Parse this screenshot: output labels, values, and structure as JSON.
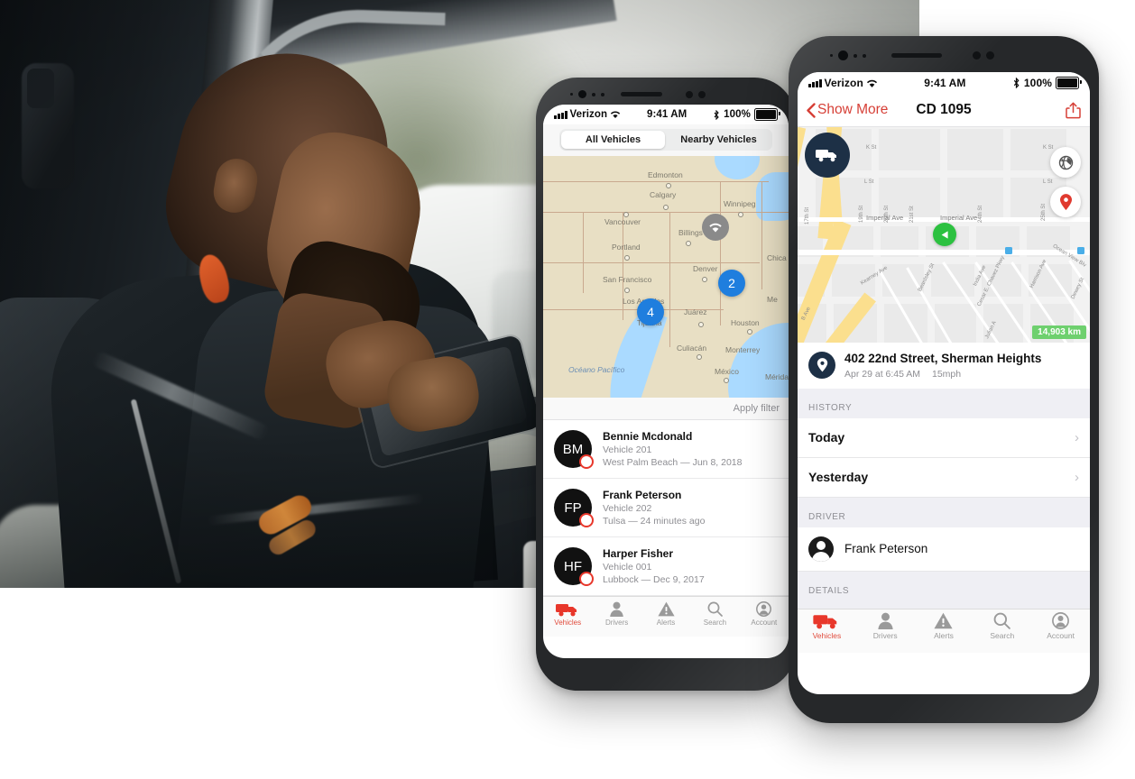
{
  "hero": {
    "alt": "delivery driver seated in truck cab using a tablet"
  },
  "phone_list": {
    "status_bar": {
      "carrier": "Verizon",
      "time": "9:41 AM",
      "battery": "100%",
      "signal_icon": "cellular-signal-icon",
      "wifi_icon": "wifi-icon",
      "bluetooth_icon": "bluetooth-icon",
      "battery_icon": "battery-icon"
    },
    "segmented": {
      "options": [
        "All Vehicles",
        "Nearby Vehicles"
      ],
      "selected": "All Vehicles"
    },
    "map": {
      "wifi_badge_icon": "wifi-badge-icon",
      "clusters": [
        {
          "count": "4"
        },
        {
          "count": "2"
        }
      ],
      "cities": [
        "Edmonton",
        "Calgary",
        "Winnipeg",
        "Vancouver",
        "Billings",
        "Portland",
        "Denver",
        "Chica",
        "San Francisco",
        "Los Angeles",
        "Juárez",
        "Tijuana",
        "Houston",
        "Culiacán",
        "Monterrey",
        "México",
        "Mérida",
        "Me",
        "Océano Pacífico"
      ]
    },
    "filter": {
      "label": "Apply filter"
    },
    "vehicles": [
      {
        "initials": "BM",
        "name": "Bennie Mcdonald",
        "vehicle": "Vehicle 201",
        "location": "West Palm Beach — Jun 8, 2018"
      },
      {
        "initials": "FP",
        "name": "Frank Peterson",
        "vehicle": "Vehicle 202",
        "location": "Tulsa — 24 minutes ago"
      },
      {
        "initials": "HF",
        "name": "Harper Fisher",
        "vehicle": "Vehicle 001",
        "location": "Lubbock — Dec 9, 2017"
      }
    ],
    "tabs": [
      {
        "label": "Vehicles",
        "icon": "truck-icon",
        "active": true
      },
      {
        "label": "Drivers",
        "icon": "person-icon",
        "active": false
      },
      {
        "label": "Alerts",
        "icon": "warning-triangle-icon",
        "active": false
      },
      {
        "label": "Search",
        "icon": "search-icon",
        "active": false
      },
      {
        "label": "Account",
        "icon": "account-circle-icon",
        "active": false
      }
    ]
  },
  "phone_detail": {
    "status_bar": {
      "carrier": "Verizon",
      "time": "9:41 AM",
      "battery": "100%"
    },
    "nav": {
      "back_label": "Show More",
      "back_icon": "chevron-left-icon",
      "title": "CD 1095",
      "share_icon": "share-icon"
    },
    "map": {
      "truck_badge_icon": "truck-marker-icon",
      "vehicle_heading_icon": "heading-arrow-icon",
      "layers_icon": "globe-layers-icon",
      "locate_icon": "map-pin-icon",
      "distance_badge": "14,903 km",
      "street_labels": [
        "K St",
        "L St",
        "Imperial Ave",
        "Imperial Ave",
        "17th St",
        "19th St",
        "20th St",
        "21st St",
        "24th St",
        "25th St",
        "Kearney Ave",
        "Beardsley St",
        "India Ave",
        "Harrison Ave",
        "Cesar E. Chavez Pkwy",
        "Ocean View Blv",
        "Dewey St",
        "Julian A",
        "B Ave",
        "25th St"
      ]
    },
    "address": {
      "title": "402 22nd Street, Sherman Heights",
      "date": "Apr 29 at 6:45 AM",
      "speed": "15mph",
      "pin_icon": "location-pin-icon"
    },
    "sections": [
      {
        "header": "HISTORY",
        "rows": [
          {
            "label": "Today"
          },
          {
            "label": "Yesterday"
          }
        ]
      },
      {
        "header": "DRIVER",
        "driver": {
          "name": "Frank Peterson",
          "avatar_icon": "avatar-icon"
        }
      },
      {
        "header": "DETAILS",
        "rows": []
      }
    ],
    "tabs": [
      {
        "label": "Vehicles",
        "icon": "truck-icon",
        "active": true
      },
      {
        "label": "Drivers",
        "icon": "person-icon",
        "active": false
      },
      {
        "label": "Alerts",
        "icon": "warning-triangle-icon",
        "active": false
      },
      {
        "label": "Search",
        "icon": "search-icon",
        "active": false
      },
      {
        "label": "Account",
        "icon": "account-circle-icon",
        "active": false
      }
    ]
  },
  "colors": {
    "accent_red": "#e04b3c",
    "nav_red": "#d63f36",
    "cluster_blue": "#1f7ede",
    "green_marker": "#2cc140",
    "distance_green": "#6ed06e",
    "navy_badge": "#1d3046"
  }
}
